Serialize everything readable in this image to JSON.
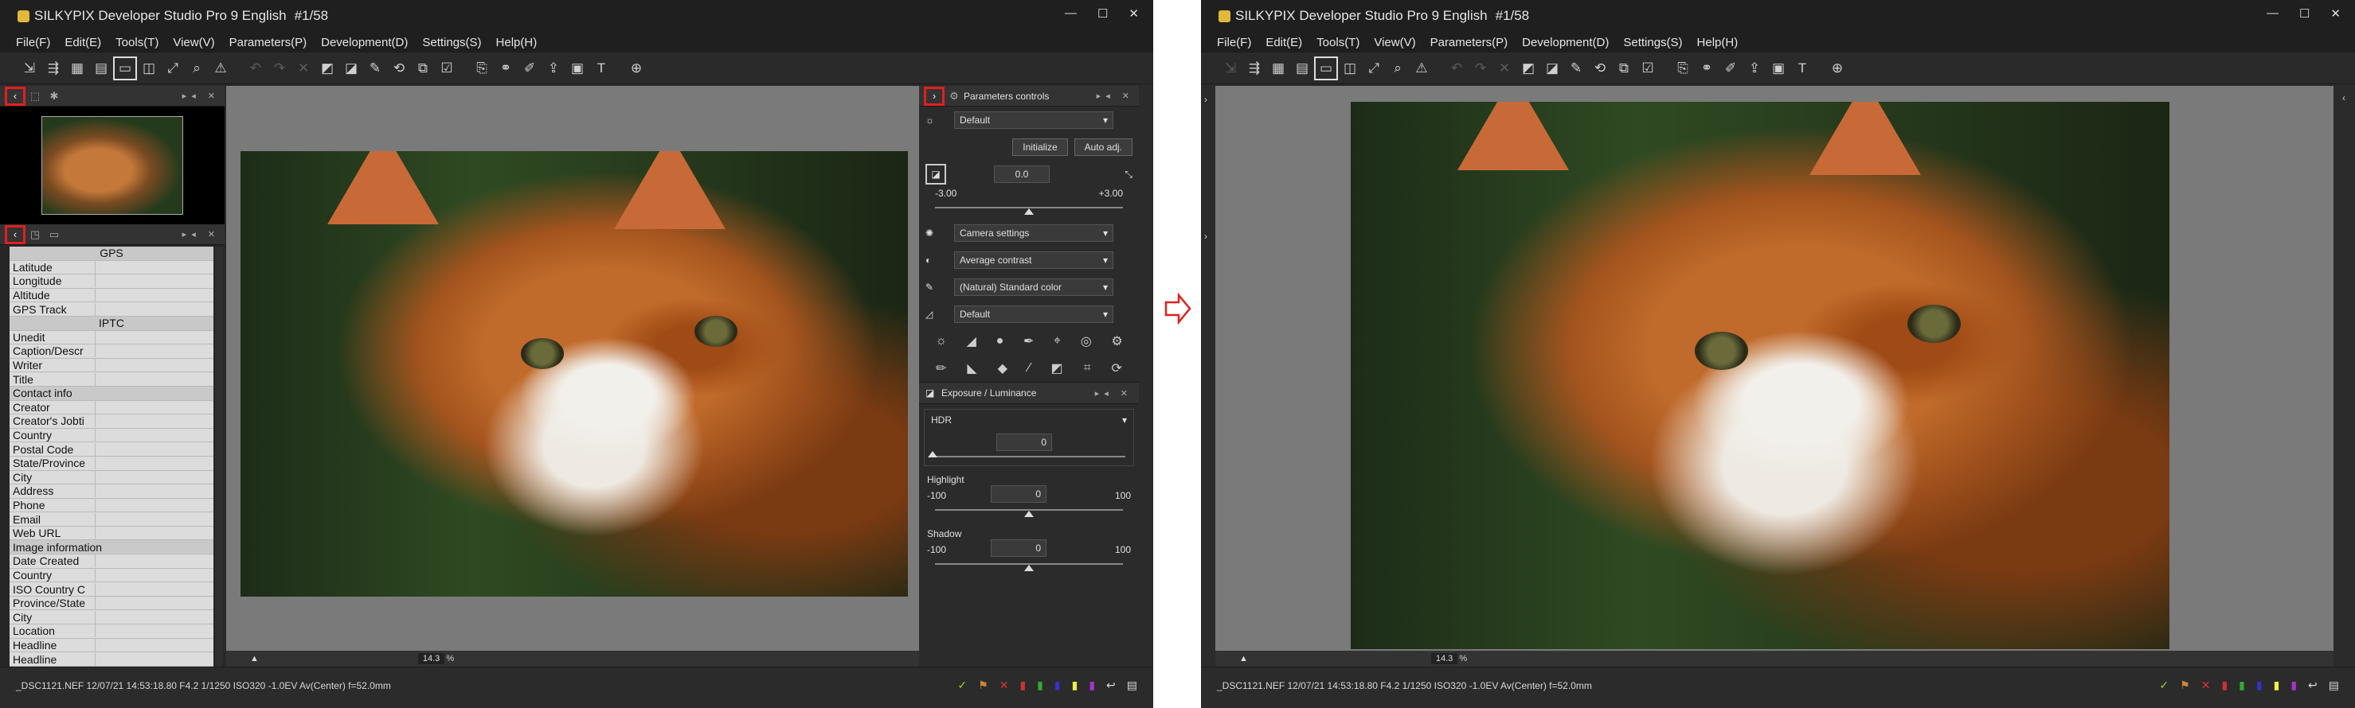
{
  "app": {
    "title": "SILKYPIX Developer Studio Pro 9 English",
    "counter": "#1/58",
    "window_controls": [
      "—",
      "☐",
      "✕"
    ]
  },
  "menu": [
    "File(F)",
    "Edit(E)",
    "Tools(T)",
    "View(V)",
    "Parameters(P)",
    "Development(D)",
    "Settings(S)",
    "Help(H)"
  ],
  "toolbar_icons": [
    "develop-icon",
    "batch-develop-icon",
    "grid-view-icon",
    "film-strip-icon",
    "single-view-icon",
    "compare-view-icon",
    "fullscreen-icon",
    "zoom-icon",
    "warning-icon",
    "undo-icon",
    "redo-icon",
    "white-balance-icon",
    "eyedropper-icon",
    "brush-icon",
    "rotate-icon",
    "crop-icon",
    "checkbox-icon",
    "stamp-icon",
    "spot-icon",
    "pen-icon",
    "export-icon",
    "monitor-icon",
    "text-icon",
    "search-zoom-icon"
  ],
  "left": {
    "info_sections": [
      {
        "type": "sec",
        "label": "GPS"
      },
      {
        "type": "row",
        "label": "Latitude"
      },
      {
        "type": "row",
        "label": "Longitude"
      },
      {
        "type": "row",
        "label": "Altitude"
      },
      {
        "type": "row",
        "label": "GPS Track"
      },
      {
        "type": "sec",
        "label": "IPTC"
      },
      {
        "type": "row",
        "label": "Unedit"
      },
      {
        "type": "row",
        "label": "Caption/Descr"
      },
      {
        "type": "row",
        "label": "Writer"
      },
      {
        "type": "row",
        "label": "Title"
      },
      {
        "type": "grp",
        "label": "Contact info"
      },
      {
        "type": "row",
        "label": "Creator"
      },
      {
        "type": "row",
        "label": "Creator's Jobti"
      },
      {
        "type": "row",
        "label": "Country"
      },
      {
        "type": "row",
        "label": "Postal Code"
      },
      {
        "type": "row",
        "label": "State/Province"
      },
      {
        "type": "row",
        "label": "City"
      },
      {
        "type": "row",
        "label": "Address"
      },
      {
        "type": "row",
        "label": "Phone"
      },
      {
        "type": "row",
        "label": "Email"
      },
      {
        "type": "row",
        "label": "Web URL"
      },
      {
        "type": "grp",
        "label": "Image information"
      },
      {
        "type": "row",
        "label": "Date Created"
      },
      {
        "type": "row",
        "label": "Country"
      },
      {
        "type": "row",
        "label": "ISO Country C"
      },
      {
        "type": "row",
        "label": "Province/State"
      },
      {
        "type": "row",
        "label": "City"
      },
      {
        "type": "row",
        "label": "Location"
      },
      {
        "type": "row",
        "label": "Headline"
      },
      {
        "type": "row",
        "label": "Headline"
      }
    ]
  },
  "params": {
    "header": "Parameters controls",
    "taste": "Default",
    "initialize": "Initialize",
    "auto_adj": "Auto adj.",
    "exposure_value": "0.0",
    "exposure_min": "-3.00",
    "exposure_max": "+3.00",
    "white_balance": "Camera settings",
    "tone": "Average contrast",
    "color": "(Natural) Standard color",
    "sharpness": "Default",
    "section2": "Exposure / Luminance",
    "hdr_label": "HDR",
    "hdr_value": "0",
    "highlight_label": "Highlight",
    "highlight_value": "0",
    "highlight_min": "-100",
    "highlight_max": "100",
    "shadow_label": "Shadow",
    "shadow_value": "0",
    "shadow_min": "-100",
    "shadow_max": "100"
  },
  "zoom": "14.3",
  "zoom_unit": "%",
  "status": "_DSC1121.NEF 12/07/21 14:53:18.80 F4.2 1/1250 ISO320 -1.0EV Av(Center) f=52.0mm",
  "colors": {
    "highlight_red": "#e02020"
  }
}
